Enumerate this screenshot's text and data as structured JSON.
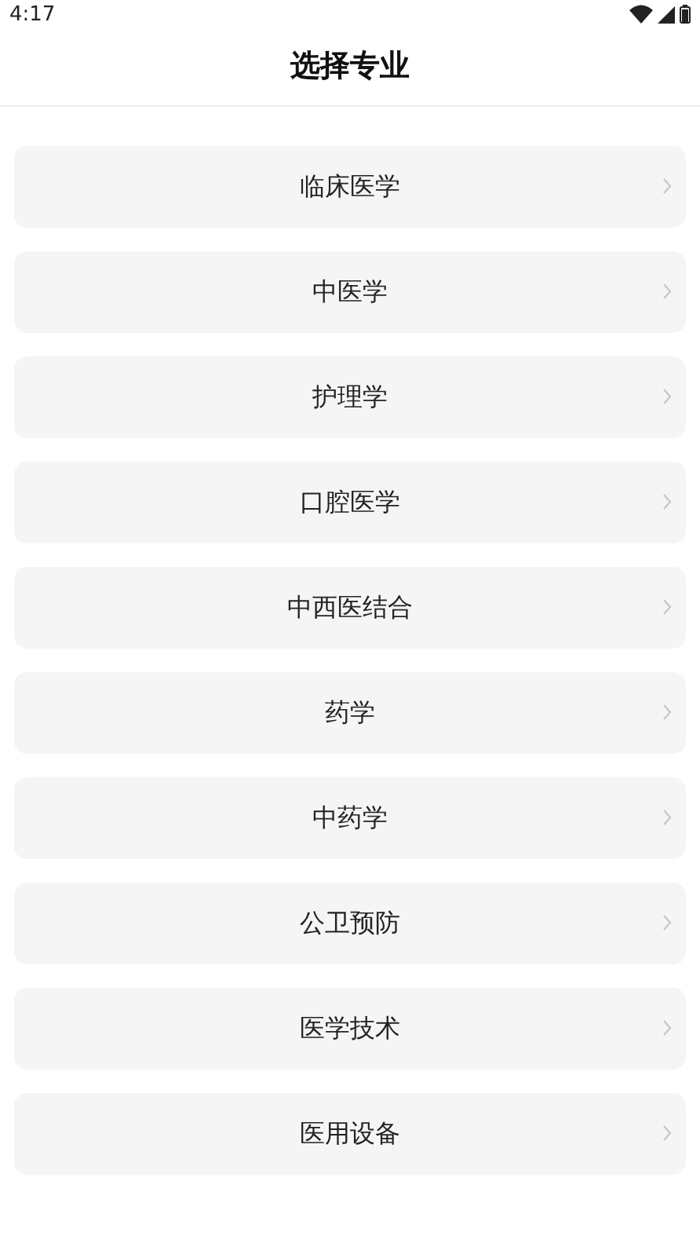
{
  "status_bar": {
    "time": "4:17"
  },
  "header": {
    "title": "选择专业"
  },
  "majors": [
    {
      "label": "临床医学"
    },
    {
      "label": "中医学"
    },
    {
      "label": "护理学"
    },
    {
      "label": "口腔医学"
    },
    {
      "label": "中西医结合"
    },
    {
      "label": "药学"
    },
    {
      "label": "中药学"
    },
    {
      "label": "公卫预防"
    },
    {
      "label": "医学技术"
    },
    {
      "label": "医用设备"
    }
  ]
}
